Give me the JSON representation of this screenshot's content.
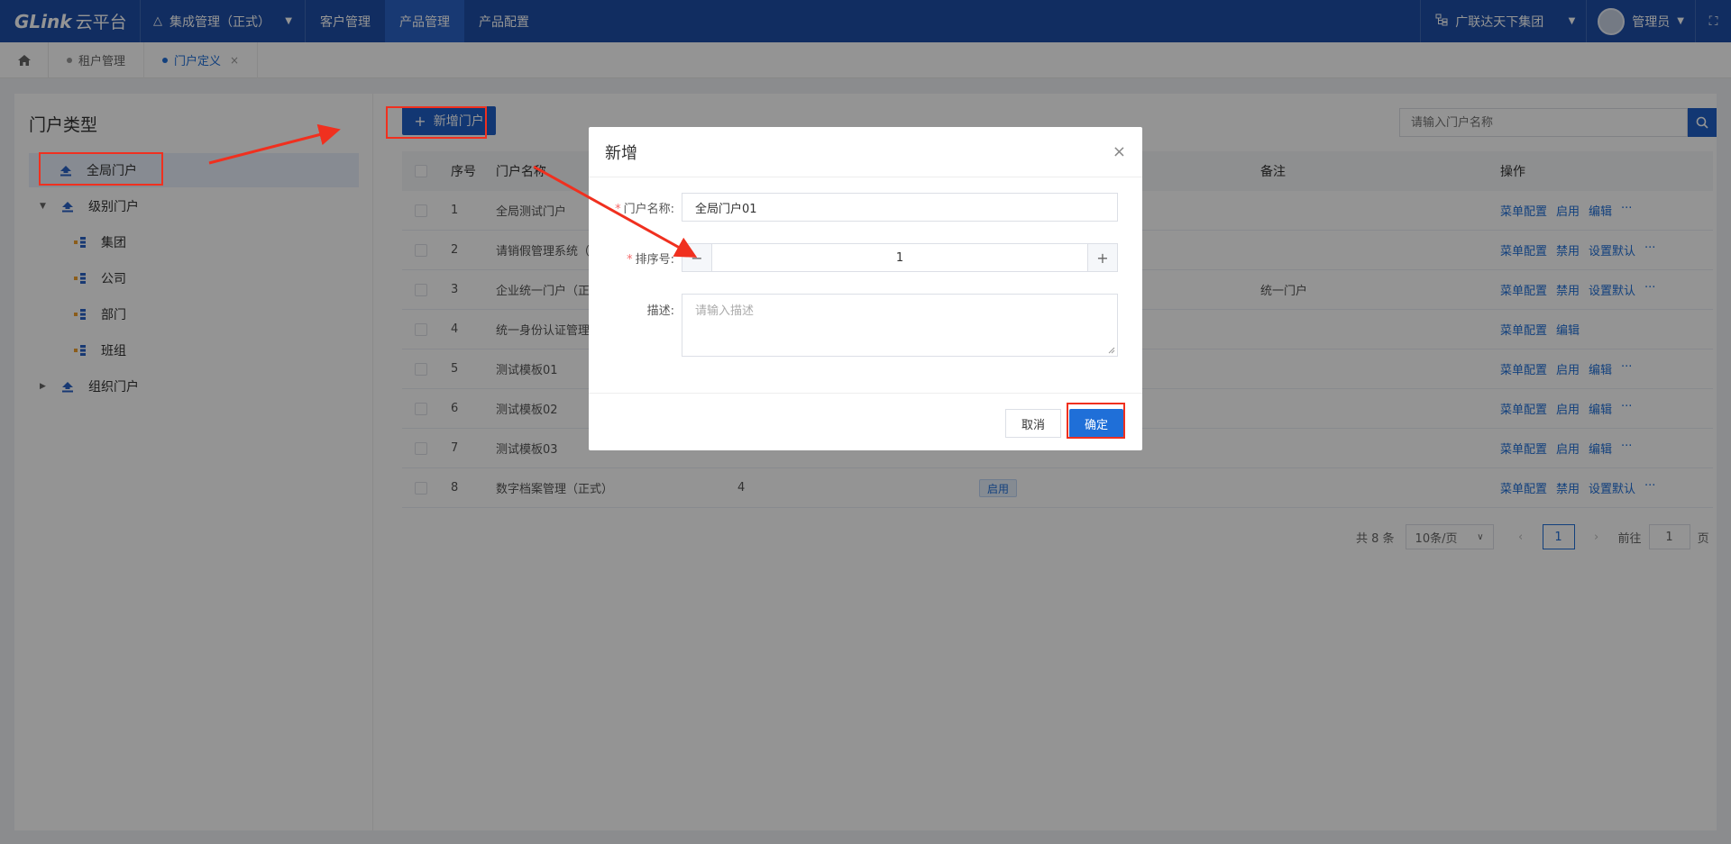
{
  "topbar": {
    "logo_en": "GLink",
    "logo_cn": "云平台",
    "system": "集成管理（正式）",
    "nav": [
      "客户管理",
      "产品管理",
      "产品配置"
    ],
    "org": "广联达天下集团",
    "user": "管理员"
  },
  "tabs": [
    {
      "label": "租户管理"
    },
    {
      "label": "门户定义"
    }
  ],
  "left": {
    "title": "门户类型",
    "tree": [
      {
        "label": "全局门户"
      },
      {
        "label": "级别门户"
      },
      {
        "label": "集团"
      },
      {
        "label": "公司"
      },
      {
        "label": "部门"
      },
      {
        "label": "班组"
      },
      {
        "label": "组织门户"
      }
    ]
  },
  "toolbar": {
    "add_label": "新增门户",
    "search_placeholder": "请输入门户名称"
  },
  "table": {
    "headers": {
      "no": "序号",
      "name": "门户名称",
      "remark": "备注",
      "ops": "操作"
    },
    "rows": [
      {
        "no": "1",
        "name": "全局测试门户",
        "sort": "",
        "status": "",
        "remark": "",
        "ops": [
          "菜单配置",
          "启用",
          "编辑",
          "···"
        ]
      },
      {
        "no": "2",
        "name": "请销假管理系统（正式）",
        "sort": "",
        "status": "",
        "remark": "",
        "ops": [
          "菜单配置",
          "禁用",
          "设置默认",
          "···"
        ]
      },
      {
        "no": "3",
        "name": "企业统一门户（正式）",
        "sort": "",
        "status": "",
        "remark": "统一门户",
        "ops": [
          "菜单配置",
          "禁用",
          "设置默认",
          "···"
        ]
      },
      {
        "no": "4",
        "name": "统一身份认证管理（正式）",
        "sort": "",
        "status": "",
        "remark": "",
        "ops": [
          "菜单配置",
          "编辑"
        ]
      },
      {
        "no": "5",
        "name": "测试模板01",
        "sort": "",
        "status": "",
        "remark": "",
        "ops": [
          "菜单配置",
          "启用",
          "编辑",
          "···"
        ]
      },
      {
        "no": "6",
        "name": "测试模板02",
        "sort": "",
        "status": "",
        "remark": "",
        "ops": [
          "菜单配置",
          "启用",
          "编辑",
          "···"
        ]
      },
      {
        "no": "7",
        "name": "测试模板03",
        "sort": "",
        "status": "",
        "remark": "",
        "ops": [
          "菜单配置",
          "启用",
          "编辑",
          "···"
        ]
      },
      {
        "no": "8",
        "name": "数字档案管理（正式）",
        "sort": "4",
        "status": "启用",
        "remark": "",
        "ops": [
          "菜单配置",
          "禁用",
          "设置默认",
          "···"
        ]
      }
    ]
  },
  "pager": {
    "total": "共 8 条",
    "size": "10条/页",
    "current": "1",
    "goto_prefix": "前往",
    "goto_value": "1",
    "goto_suffix": "页"
  },
  "dialog": {
    "title": "新增",
    "name_label": "门户名称:",
    "name_value": "全局门户01",
    "sort_label": "排序号:",
    "sort_value": "1",
    "desc_label": "描述:",
    "desc_placeholder": "请输入描述",
    "cancel": "取消",
    "ok": "确定"
  }
}
